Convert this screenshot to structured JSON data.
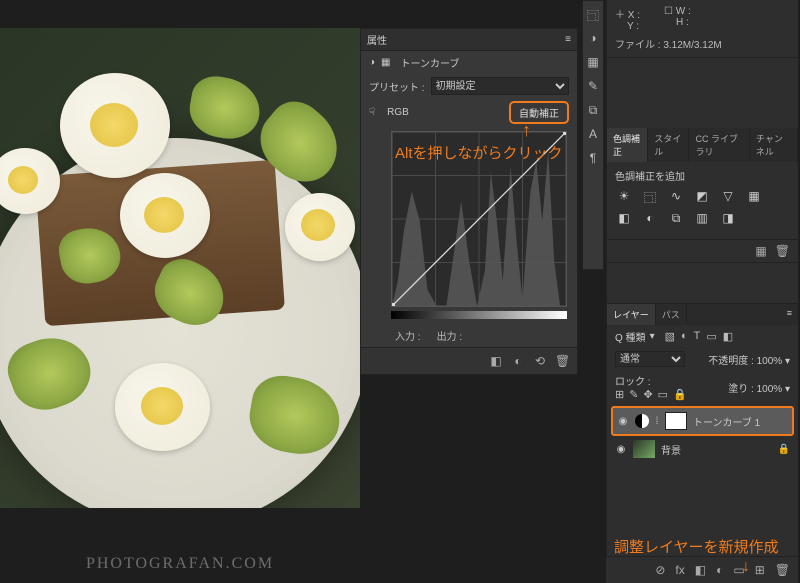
{
  "watermark": "PHOTOGRAFAN.COM",
  "properties": {
    "title": "属性",
    "adjustment_type": "トーンカーブ",
    "preset_label": "プリセット :",
    "preset_value": "初期設定",
    "channel_label": "RGB",
    "auto_button": "自動補正",
    "input_label": "入力 :",
    "output_label": "出力 :"
  },
  "info": {
    "x_label": "X :",
    "y_label": "Y :",
    "w_label": "W :",
    "h_label": "H :",
    "file_label": "ファイル :",
    "file_value": "3.12M/3.12M"
  },
  "adjustments_panel": {
    "tabs": [
      "色調補正",
      "スタイル",
      "CC ライブラリ",
      "チャンネル"
    ],
    "add_label": "色調補正を追加"
  },
  "layers_panel": {
    "tabs": [
      "レイヤー",
      "パス"
    ],
    "kind_label": "Q 種類",
    "blend_mode": "通常",
    "opacity_label": "不透明度 :",
    "opacity_value": "100%",
    "lock_label": "ロック :",
    "fill_label": "塗り :",
    "fill_value": "100%",
    "layers": [
      {
        "name": "トーンカーブ 1",
        "type": "adjustment",
        "visible": true,
        "selected": true
      },
      {
        "name": "背景",
        "type": "background",
        "visible": true,
        "locked": true
      }
    ]
  },
  "annotations": {
    "alt_click": "Altを押しながらクリック",
    "new_adjustment": "調整レイヤーを新規作成"
  },
  "icons": {
    "curve": "◑",
    "menu": "≡",
    "dropdown": "▾",
    "eye": "◉",
    "reset": "⟲",
    "clip": "◧",
    "prev": "◐",
    "trash": "🗑",
    "fx": "fx",
    "mask": "◧",
    "adj": "◐",
    "group": "▭",
    "new": "⊞",
    "link": "⊘",
    "brush": "✎",
    "lock": "🔒"
  }
}
